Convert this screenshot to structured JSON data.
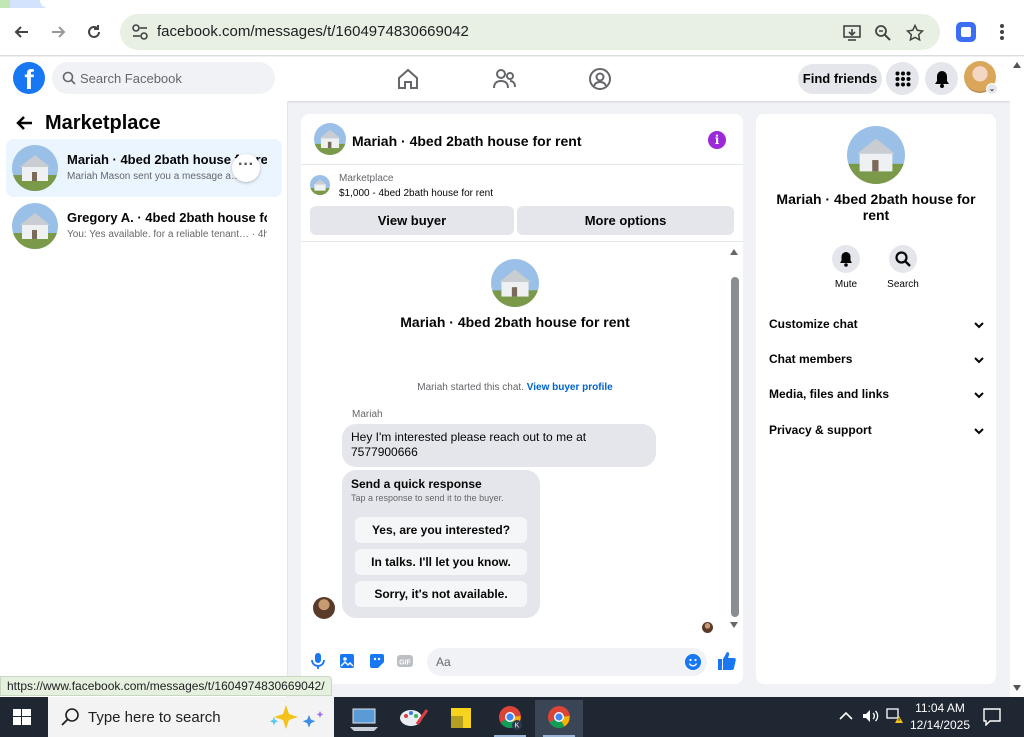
{
  "browser": {
    "url": "facebook.com/messages/t/1604974830669042",
    "status_url": "https://www.facebook.com/messages/t/1604974830669042/"
  },
  "fb_header": {
    "search_placeholder": "Search Facebook",
    "find_friends": "Find friends"
  },
  "left_panel": {
    "title": "Marketplace",
    "conversations": [
      {
        "name": "Mariah · 4bed 2bath house for rent",
        "preview": "Mariah Mason sent you a message a… 2h"
      },
      {
        "name": "Gregory A. · 4bed 2bath house for…",
        "preview": "You: Yes available. for a reliable tenant… · 4h"
      }
    ]
  },
  "chat": {
    "title": "Mariah · 4bed 2bath house for rent",
    "listing_category": "Marketplace",
    "listing_price": "$1,000 - 4bed 2bath house for rent",
    "view_buyer": "View buyer",
    "more_options": "More options",
    "big_title": "Mariah · 4bed 2bath house for rent",
    "started_text": "Mariah started this chat.",
    "view_buyer_profile": "View buyer profile",
    "sender": "Mariah",
    "message": "Hey I'm interested please reach out to me at 7577900666",
    "quick_response_title": "Send a quick response",
    "quick_response_sub": "Tap a response to send it to the buyer.",
    "quick_responses": [
      "Yes, are you interested?",
      "In talks. I'll let you know.",
      "Sorry, it's not available."
    ],
    "input_placeholder": "Aa"
  },
  "right_panel": {
    "name": "Mariah · 4bed 2bath house for rent",
    "mute": "Mute",
    "search": "Search",
    "sections": [
      "Customize chat",
      "Chat members",
      "Media, files and links",
      "Privacy & support"
    ]
  },
  "taskbar": {
    "search_placeholder": "Type here to search",
    "time": "11:04 AM",
    "date": "12/14/2025"
  },
  "colors": {
    "facebook_blue": "#1877f2",
    "info_purple": "#9b2bd8",
    "link_blue": "#0064d1"
  }
}
